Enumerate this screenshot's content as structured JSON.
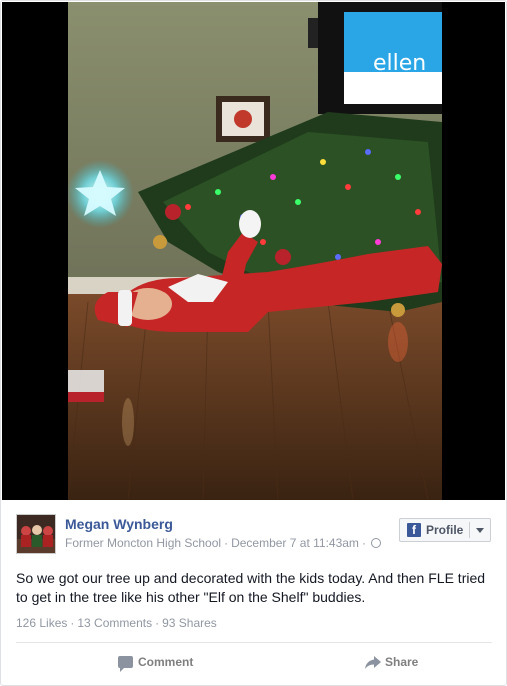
{
  "post": {
    "author": "Megan Wynberg",
    "school": "Former Moncton High School",
    "date": "December 7 at 11:43am",
    "separator": "·",
    "text": "So we got our tree up and decorated with the kids today. And then FLE tried to get in the tree like his other \"Elf on the Shelf\" buddies.",
    "profile_button": "Profile",
    "tv_logo_text": "ellen"
  },
  "stats": {
    "likes": "126 Likes",
    "comments": "13 Comments",
    "shares": "93 Shares"
  },
  "actions": {
    "comment": "Comment",
    "share": "Share"
  },
  "icons": {
    "profile_badge": "facebook-f-icon",
    "privacy": "globe-icon",
    "comment": "comment-bubble-icon",
    "share": "share-arrow-icon",
    "dropdown": "chevron-down-icon"
  },
  "colors": {
    "author_link": "#3b5998",
    "meta_text": "#9197a3",
    "facebook_blue": "#3b5998"
  }
}
